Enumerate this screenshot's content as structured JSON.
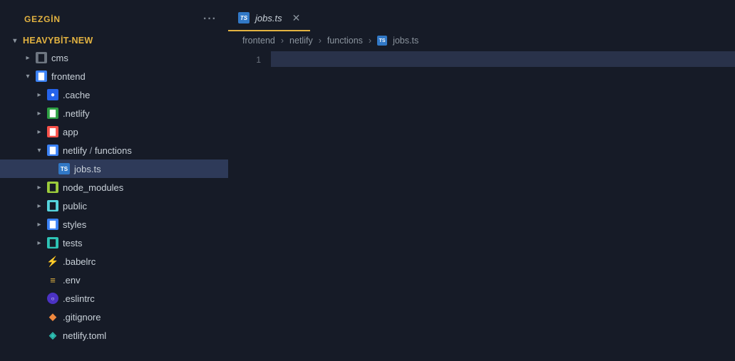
{
  "sidebar": {
    "title": "GEZGİN",
    "project": "HEAVYBİT-NEW",
    "tree": [
      {
        "label": "cms",
        "icon": "folder-grey",
        "depth": 1,
        "chev": "right"
      },
      {
        "label": "frontend",
        "icon": "folder-blue",
        "depth": 1,
        "chev": "down"
      },
      {
        "label": ".cache",
        "icon": "dot-blue",
        "depth": 2,
        "chev": "right"
      },
      {
        "label": ".netlify",
        "icon": "folder-green",
        "depth": 2,
        "chev": "right"
      },
      {
        "label": "app",
        "icon": "folder-red",
        "depth": 2,
        "chev": "right"
      },
      {
        "label": "netlify / functions",
        "icon": "folder-blue",
        "depth": 2,
        "chev": "down"
      },
      {
        "label": "jobs.ts",
        "icon": "file-ts",
        "depth": 3,
        "chev": "",
        "selected": true
      },
      {
        "label": "node_modules",
        "icon": "folder-lime",
        "depth": 2,
        "chev": "right"
      },
      {
        "label": "public",
        "icon": "folder-cyan",
        "depth": 2,
        "chev": "right"
      },
      {
        "label": "styles",
        "icon": "folder-blue",
        "depth": 2,
        "chev": "right"
      },
      {
        "label": "tests",
        "icon": "folder-teal",
        "depth": 2,
        "chev": "right"
      },
      {
        "label": ".babelrc",
        "icon": "file-yellow",
        "depth": 2,
        "chev": ""
      },
      {
        "label": ".env",
        "icon": "file-bars",
        "depth": 2,
        "chev": ""
      },
      {
        "label": ".eslintrc",
        "icon": "file-eslint",
        "depth": 2,
        "chev": ""
      },
      {
        "label": ".gitignore",
        "icon": "file-git",
        "depth": 2,
        "chev": ""
      },
      {
        "label": "netlify.toml",
        "icon": "file-netlify",
        "depth": 2,
        "chev": ""
      }
    ]
  },
  "tab": {
    "label": "jobs.ts",
    "icon": "file-ts"
  },
  "breadcrumb": {
    "segments": [
      "frontend",
      "netlify",
      "functions",
      "jobs.ts"
    ]
  },
  "gutter": {
    "line1": "1"
  }
}
